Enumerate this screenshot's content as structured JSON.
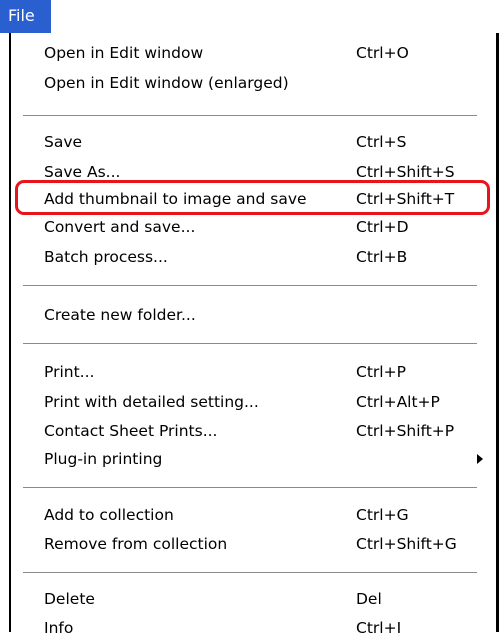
{
  "menubar": {
    "file_label": "File"
  },
  "colors": {
    "menubar_active": "#2a5fd0",
    "highlight_outline": "#e8141c"
  },
  "menu": {
    "open_edit": {
      "label": "Open in Edit window",
      "shortcut": "Ctrl+O"
    },
    "open_edit_enlarged": {
      "label": "Open in Edit window (enlarged)"
    },
    "save": {
      "label": "Save",
      "shortcut": "Ctrl+S"
    },
    "save_as": {
      "label": "Save As...",
      "shortcut": "Ctrl+Shift+S"
    },
    "add_thumbnail": {
      "label": "Add thumbnail to image and save",
      "shortcut": "Ctrl+Shift+T"
    },
    "convert_save": {
      "label": "Convert and save...",
      "shortcut": "Ctrl+D"
    },
    "batch_process": {
      "label": "Batch process...",
      "shortcut": "Ctrl+B"
    },
    "create_folder": {
      "label": "Create new folder..."
    },
    "print": {
      "label": "Print...",
      "shortcut": "Ctrl+P"
    },
    "print_detailed": {
      "label": "Print with detailed setting...",
      "shortcut": "Ctrl+Alt+P"
    },
    "contact_sheet": {
      "label": "Contact Sheet Prints...",
      "shortcut": "Ctrl+Shift+P"
    },
    "plugin_printing": {
      "label": "Plug-in printing"
    },
    "add_collection": {
      "label": "Add to collection",
      "shortcut": "Ctrl+G"
    },
    "remove_collection": {
      "label": "Remove from collection",
      "shortcut": "Ctrl+Shift+G"
    },
    "delete": {
      "label": "Delete",
      "shortcut": "Del"
    },
    "info": {
      "label": "Info",
      "shortcut": "Ctrl+I"
    }
  }
}
